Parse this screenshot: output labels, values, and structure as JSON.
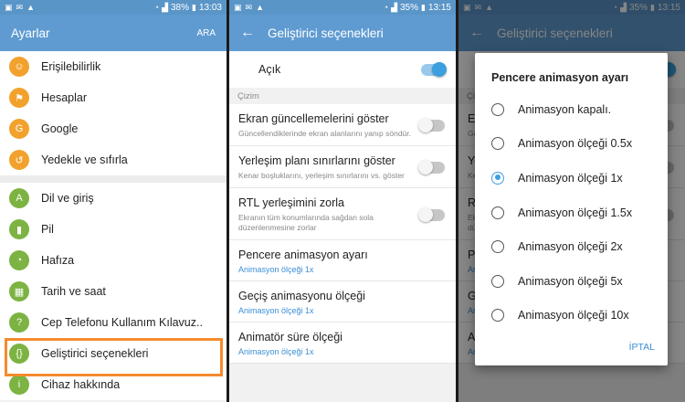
{
  "panel1": {
    "status": {
      "battery": "38%",
      "time": "13:03"
    },
    "title": "Ayarlar",
    "action": "ARA",
    "group1": [
      {
        "label": "Erişilebilirlik",
        "icon": "accessibility-icon",
        "color": "#f2a22c",
        "glyph": "☺"
      },
      {
        "label": "Hesaplar",
        "icon": "key-icon",
        "color": "#f2a22c",
        "glyph": "⚑"
      },
      {
        "label": "Google",
        "icon": "google-icon",
        "color": "#f2a22c",
        "glyph": "G"
      },
      {
        "label": "Yedekle ve sıfırla",
        "icon": "backup-icon",
        "color": "#f2a22c",
        "glyph": "↺"
      }
    ],
    "group2": [
      {
        "label": "Dil ve giriş",
        "icon": "language-icon",
        "color": "#7cb342",
        "glyph": "A"
      },
      {
        "label": "Pil",
        "icon": "battery-icon",
        "color": "#7cb342",
        "glyph": "▮"
      },
      {
        "label": "Hafıza",
        "icon": "memory-icon",
        "color": "#7cb342",
        "glyph": "◔"
      },
      {
        "label": "Tarih ve saat",
        "icon": "calendar-icon",
        "color": "#7cb342",
        "glyph": "▦"
      },
      {
        "label": "Cep Telefonu Kullanım Kılavuz..",
        "icon": "manual-icon",
        "color": "#7cb342",
        "glyph": "?"
      },
      {
        "label": "Geliştirici seçenekleri",
        "icon": "developer-icon",
        "color": "#7cb342",
        "glyph": "{}"
      },
      {
        "label": "Cihaz hakkında",
        "icon": "info-icon",
        "color": "#7cb342",
        "glyph": "i"
      }
    ]
  },
  "panel2": {
    "status": {
      "battery": "35%",
      "time": "13:15"
    },
    "title": "Geliştirici seçenekleri",
    "master": {
      "label": "Açık",
      "on": true
    },
    "section": "Çizim",
    "rows": [
      {
        "title": "Ekran güncellemelerini göster",
        "sub": "Güncellendiklerinde ekran alanlarını yanıp söndür.",
        "toggle": true
      },
      {
        "title": "Yerleşim planı sınırlarını göster",
        "sub": "Kenar boşluklarını, yerleşim sınırlarını vs. göster",
        "toggle": true
      },
      {
        "title": "RTL yerleşimini zorla",
        "sub": "Ekranın tüm konumlarında sağdan sola düzenlenmesine zorlar",
        "toggle": true
      },
      {
        "title": "Pencere animasyon ayarı",
        "value": "Animasyon ölçeği 1x"
      },
      {
        "title": "Geçiş animasyonu ölçeği",
        "value": "Animasyon ölçeği 1x"
      },
      {
        "title": "Animatör süre ölçeği",
        "value": "Animasyon ölçeği 1x"
      }
    ]
  },
  "panel3": {
    "status": {
      "battery": "35%",
      "time": "13:15"
    },
    "title": "Geliştirici seçenekleri",
    "dialog": {
      "title": "Pencere animasyon ayarı",
      "options": [
        "Animasyon kapalı.",
        "Animasyon ölçeği 0.5x",
        "Animasyon ölçeği 1x",
        "Animasyon ölçeği 1.5x",
        "Animasyon ölçeği 2x",
        "Animasyon ölçeği 5x",
        "Animasyon ölçeği 10x"
      ],
      "selected_index": 2,
      "cancel": "İPTAL"
    }
  },
  "colors": {
    "accent": "#3b9fe0",
    "appbar": "#5f9bd1",
    "highlight": "#f58a2c"
  }
}
